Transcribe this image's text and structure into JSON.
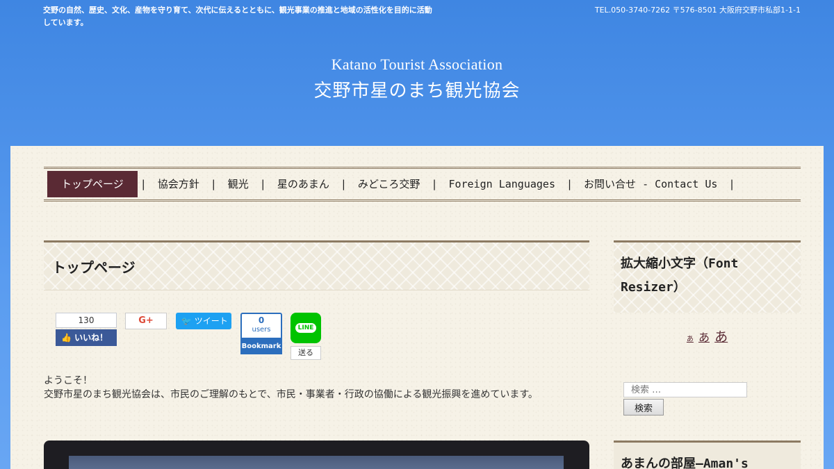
{
  "header": {
    "tagline": "交野の自然、歴史、文化、産物を守り育て、次代に伝えるとともに、観光事業の推進と地域の活性化を目的に活動しています。",
    "contact": "TEL.050-3740-7262  〒576-8501 大阪府交野市私部1-1-1",
    "logo_en": "Katano Tourist Association",
    "logo_jp": "交野市星のまち観光協会"
  },
  "nav": {
    "items": [
      {
        "label": "トップページ"
      },
      {
        "label": "協会方針"
      },
      {
        "label": "観光"
      },
      {
        "label": "星のあまん"
      },
      {
        "label": "みどころ交野"
      },
      {
        "label": "Foreign Languages"
      },
      {
        "label": "お問い合せ - Contact Us"
      }
    ],
    "separator": "|"
  },
  "main": {
    "title": "トップページ",
    "share": {
      "fb_count": "130",
      "fb_label": "いいね！",
      "gplus_label": "G+",
      "tweet_label": "ツイート",
      "hatena_count": "0",
      "hatena_users": "users",
      "hatena_label": "Bookmark",
      "line_label": "LINE",
      "line_send": "送る"
    },
    "welcome_line1": "ようこそ！",
    "welcome_line2": "交野市星のまち観光協会は、市民のご理解のもとで、市民・事業者・行政の協働による観光振興を進めています。"
  },
  "sidebar": {
    "font_resizer_title": "拡大縮小文字（Font Resizer）",
    "font_small": "あ",
    "font_medium": "あ",
    "font_large": "あ",
    "search_placeholder": "検索 …",
    "search_button": "検索",
    "next_widget_title": "あまんの部屋―Aman's"
  },
  "colors": {
    "sky": "#4a8fe8",
    "panel": "#f6f2e7",
    "nav_active": "#5a2a34",
    "accent_border": "#8c7a62"
  }
}
